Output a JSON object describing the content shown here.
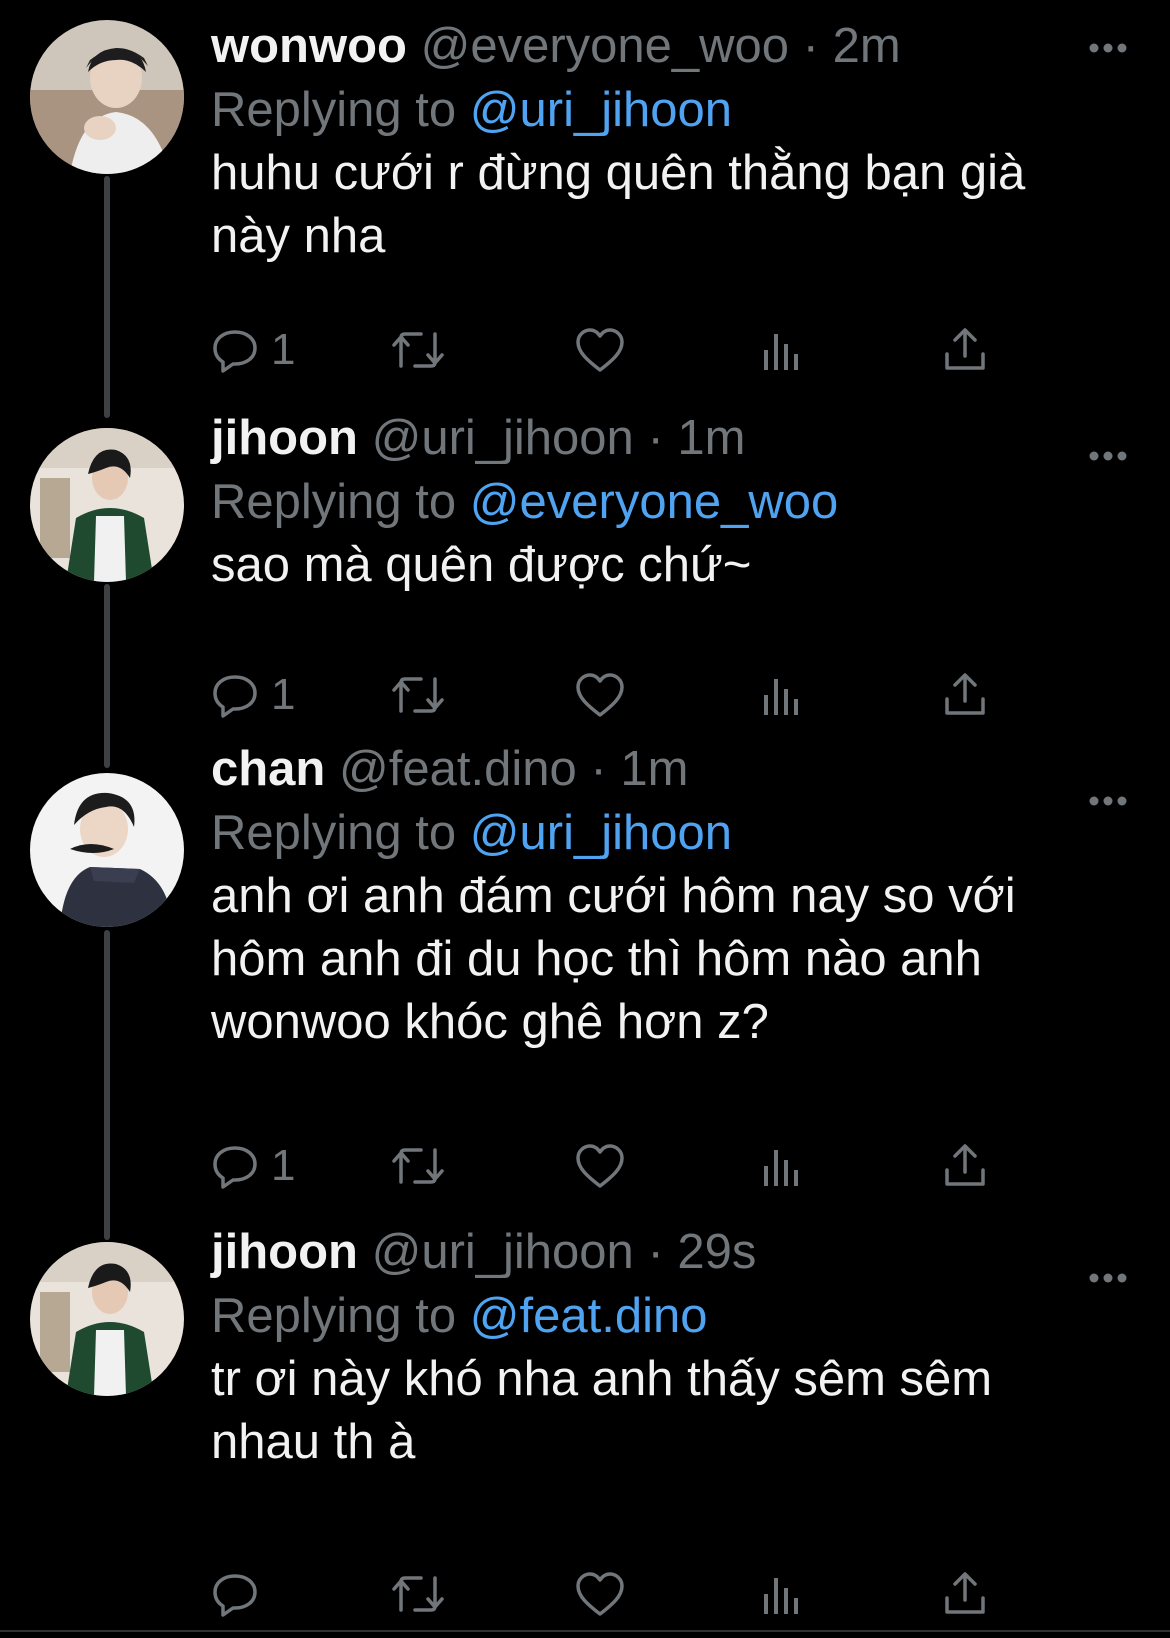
{
  "tweets": [
    {
      "display_name": "wonwoo",
      "handle": "@everyone_woo",
      "dot": "·",
      "time": "2m",
      "replying_label": "Replying to",
      "replying_to": "@uri_jihoon",
      "text": "huhu cưới r đừng quên thằng bạn già này nha",
      "reply_count": "1"
    },
    {
      "display_name": "jihoon",
      "handle": "@uri_jihoon",
      "dot": "·",
      "time": "1m",
      "replying_label": "Replying to",
      "replying_to": "@everyone_woo",
      "text": "sao mà quên được chứ~",
      "reply_count": "1"
    },
    {
      "display_name": "chan",
      "handle": "@feat.dino",
      "dot": "·",
      "time": "1m",
      "replying_label": "Replying to",
      "replying_to": "@uri_jihoon",
      "text": "anh ơi anh đám cưới hôm nay so với hôm anh đi du học thì hôm nào anh wonwoo khóc ghê hơn z?",
      "reply_count": "1"
    },
    {
      "display_name": "jihoon",
      "handle": "@uri_jihoon",
      "dot": "·",
      "time": "29s",
      "replying_label": "Replying to",
      "replying_to": "@feat.dino",
      "text": "tr ơi này khó nha anh thấy sêm sêm nhau th à",
      "reply_count": ""
    }
  ],
  "icons": {
    "reply": "reply-icon",
    "retweet": "retweet-icon",
    "like": "like-icon",
    "analytics": "analytics-icon",
    "share": "share-icon",
    "more": "more-icon"
  },
  "colors": {
    "background": "#000000",
    "text_primary": "#f2f2f2",
    "text_secondary": "#71767b",
    "mention": "#4fa3f0",
    "thread_line": "#3e4144"
  }
}
